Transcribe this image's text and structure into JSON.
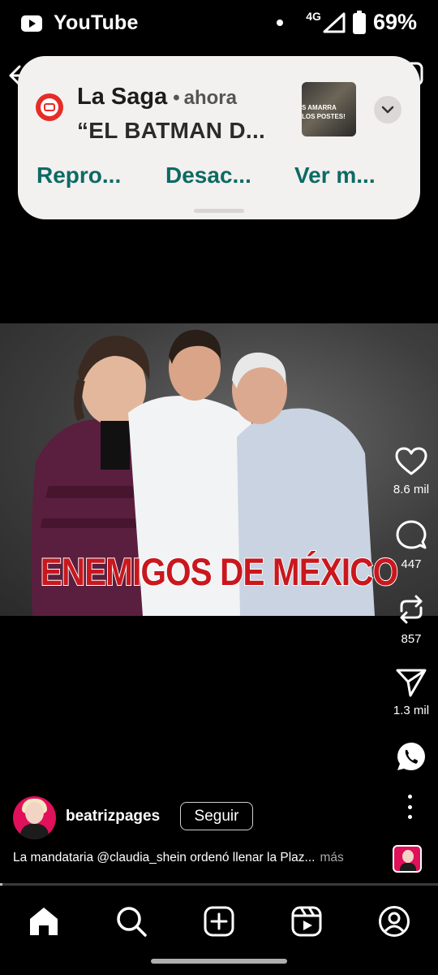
{
  "status_bar": {
    "app_label": "YouTube",
    "network": "4G",
    "battery": "69%"
  },
  "notification": {
    "app_name": "La Saga",
    "separator": "•",
    "time": "ahora",
    "title": "“EL BATMAN D...",
    "thumbnail_text_1": "S AMARRA",
    "thumbnail_text_2": "LOS POSTES!",
    "actions": [
      {
        "label": "Repro..."
      },
      {
        "label": "Desac..."
      },
      {
        "label": "Ver m..."
      }
    ]
  },
  "post": {
    "image_caption": "ENEMIGOS DE MÉXICO",
    "author": "beatrizpages",
    "follow_label": "Seguir",
    "caption_text": "La mandataria @claudia_shein ordenó llenar la Plaz...",
    "caption_more": "más",
    "progress_fraction": 0.005
  },
  "actions": {
    "likes": "8.6 mil",
    "comments": "447",
    "reposts": "857",
    "shares": "1.3 mil"
  },
  "nav": {
    "items": [
      "home-icon",
      "search-icon",
      "create-icon",
      "reels-icon",
      "profile-icon"
    ]
  },
  "colors": {
    "notification_bg": "#f3f0f0",
    "notification_action": "#0c6b63",
    "youtube_red": "#e52d27",
    "overlay_red": "#c8181e",
    "avatar_pink": "#e0105b"
  }
}
